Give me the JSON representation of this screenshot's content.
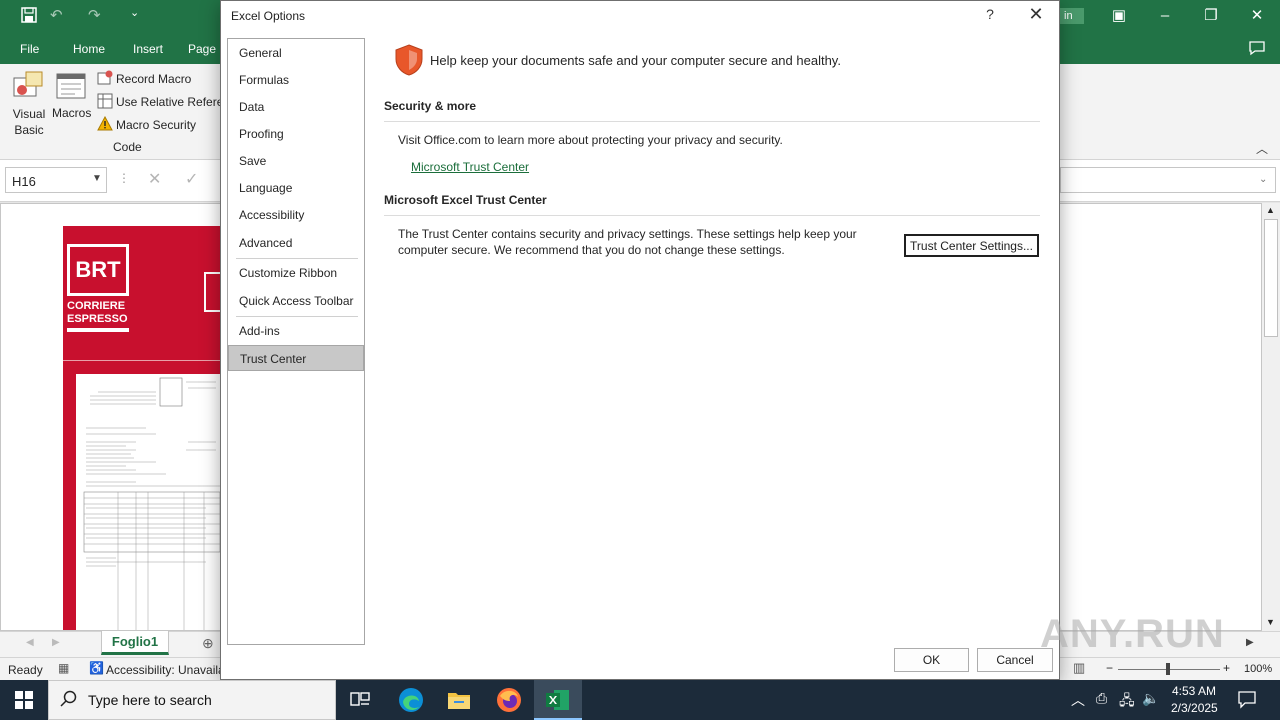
{
  "excel": {
    "ribbon_tabs": [
      "File",
      "Home",
      "Insert",
      "Page L"
    ],
    "ribbon": {
      "visual_basic": "Visual Basic",
      "macros": "Macros",
      "record_macro": "Record Macro",
      "use_relative": "Use Relative Referer",
      "macro_security": "Macro Security",
      "group_code": "Code"
    },
    "name_box": "H16",
    "sheet_tab": "Foglio1",
    "status_ready": "Ready",
    "status_accessibility": "Accessibility: Unavailab",
    "zoom": "100%",
    "signin_fragment": "in",
    "doc_logo": "BRT",
    "doc_sub1": "CORRIERE",
    "doc_sub2": "ESPRESSO"
  },
  "dialog": {
    "title": "Excel Options",
    "help_icon": "?",
    "nav": [
      "General",
      "Formulas",
      "Data",
      "Proofing",
      "Save",
      "Language",
      "Accessibility",
      "Advanced",
      "Customize Ribbon",
      "Quick Access Toolbar",
      "Add-ins",
      "Trust Center"
    ],
    "header_text": "Help keep your documents safe and your computer secure and healthy.",
    "section1_heading": "Security & more",
    "section1_text": "Visit Office.com to learn more about protecting your privacy and security.",
    "section1_link": "Microsoft Trust Center",
    "section2_heading": "Microsoft Excel Trust Center",
    "section2_text_line1": "The Trust Center contains security and privacy settings. These settings help keep your",
    "section2_text_line2": "computer secure. We recommend that you do not change these settings.",
    "trust_button": "Trust Center Settings...",
    "ok": "OK",
    "cancel": "Cancel"
  },
  "taskbar": {
    "search_placeholder": "Type here to search",
    "time": "4:53 AM",
    "date": "2/3/2025"
  },
  "watermark": "ANY.RUN",
  "colors": {
    "excel_green": "#217346",
    "taskbar": "#1c2b3a",
    "link_green": "#1b6e3b",
    "shield_orange": "#e8572a",
    "brt_red": "#c8102e"
  }
}
